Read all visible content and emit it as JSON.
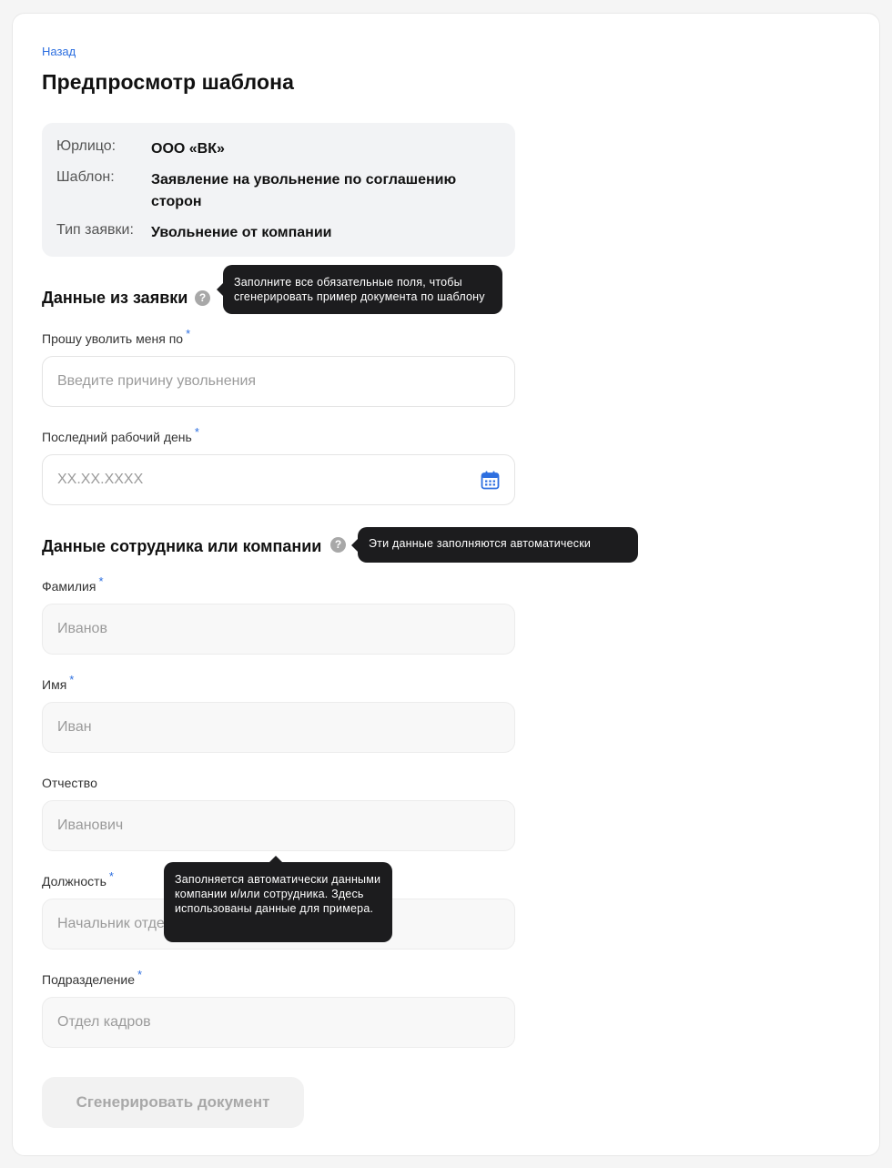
{
  "header": {
    "back_label": "Назад",
    "title": "Предпросмотр шаблона"
  },
  "info": {
    "entity_label": "Юрлицо:",
    "entity_value": "ООО «ВК»",
    "template_label": "Шаблон:",
    "template_value": "Заявление на увольнение по соглашению сторон",
    "request_type_label": "Тип заявки:",
    "request_type_value": "Увольнение от компании"
  },
  "request_section": {
    "title": "Данные из заявки",
    "help_glyph": "?",
    "tooltip": "Заполните все обязательные поля, чтобы сгенерировать пример документа по шаблону",
    "fields": {
      "reason": {
        "label": "Прошу уволить меня по",
        "required_mark": "*",
        "placeholder": "Введите причину увольнения"
      },
      "last_day": {
        "label": "Последний рабочий день",
        "required_mark": "*",
        "placeholder": "XX.XX.XXXX",
        "icon": "calendar-icon"
      }
    }
  },
  "employee_section": {
    "title": "Данные сотрудника или компании",
    "help_glyph": "?",
    "tooltip": "Эти данные заполняются автоматически",
    "fields": {
      "last_name": {
        "label": "Фамилия",
        "required_mark": "*",
        "placeholder": "Иванов"
      },
      "first_name": {
        "label": "Имя",
        "required_mark": "*",
        "placeholder": "Иван"
      },
      "patronymic": {
        "label": "Отчество",
        "placeholder": "Иванович"
      },
      "position": {
        "label": "Должность",
        "required_mark": "*",
        "placeholder": "Начальник отдела кадров"
      },
      "department": {
        "label": "Подразделение",
        "required_mark": "*",
        "placeholder": "Отдел кадров"
      }
    },
    "autofill_tooltip": "Заполняется автоматически данными компании и/или сотрудника. Здесь использованы данные для примера."
  },
  "actions": {
    "generate_label": "Сгенерировать документ"
  },
  "colors": {
    "accent": "#2d6fe0",
    "tooltip_bg": "#1c1c1e",
    "panel_bg": "#f2f3f5"
  }
}
